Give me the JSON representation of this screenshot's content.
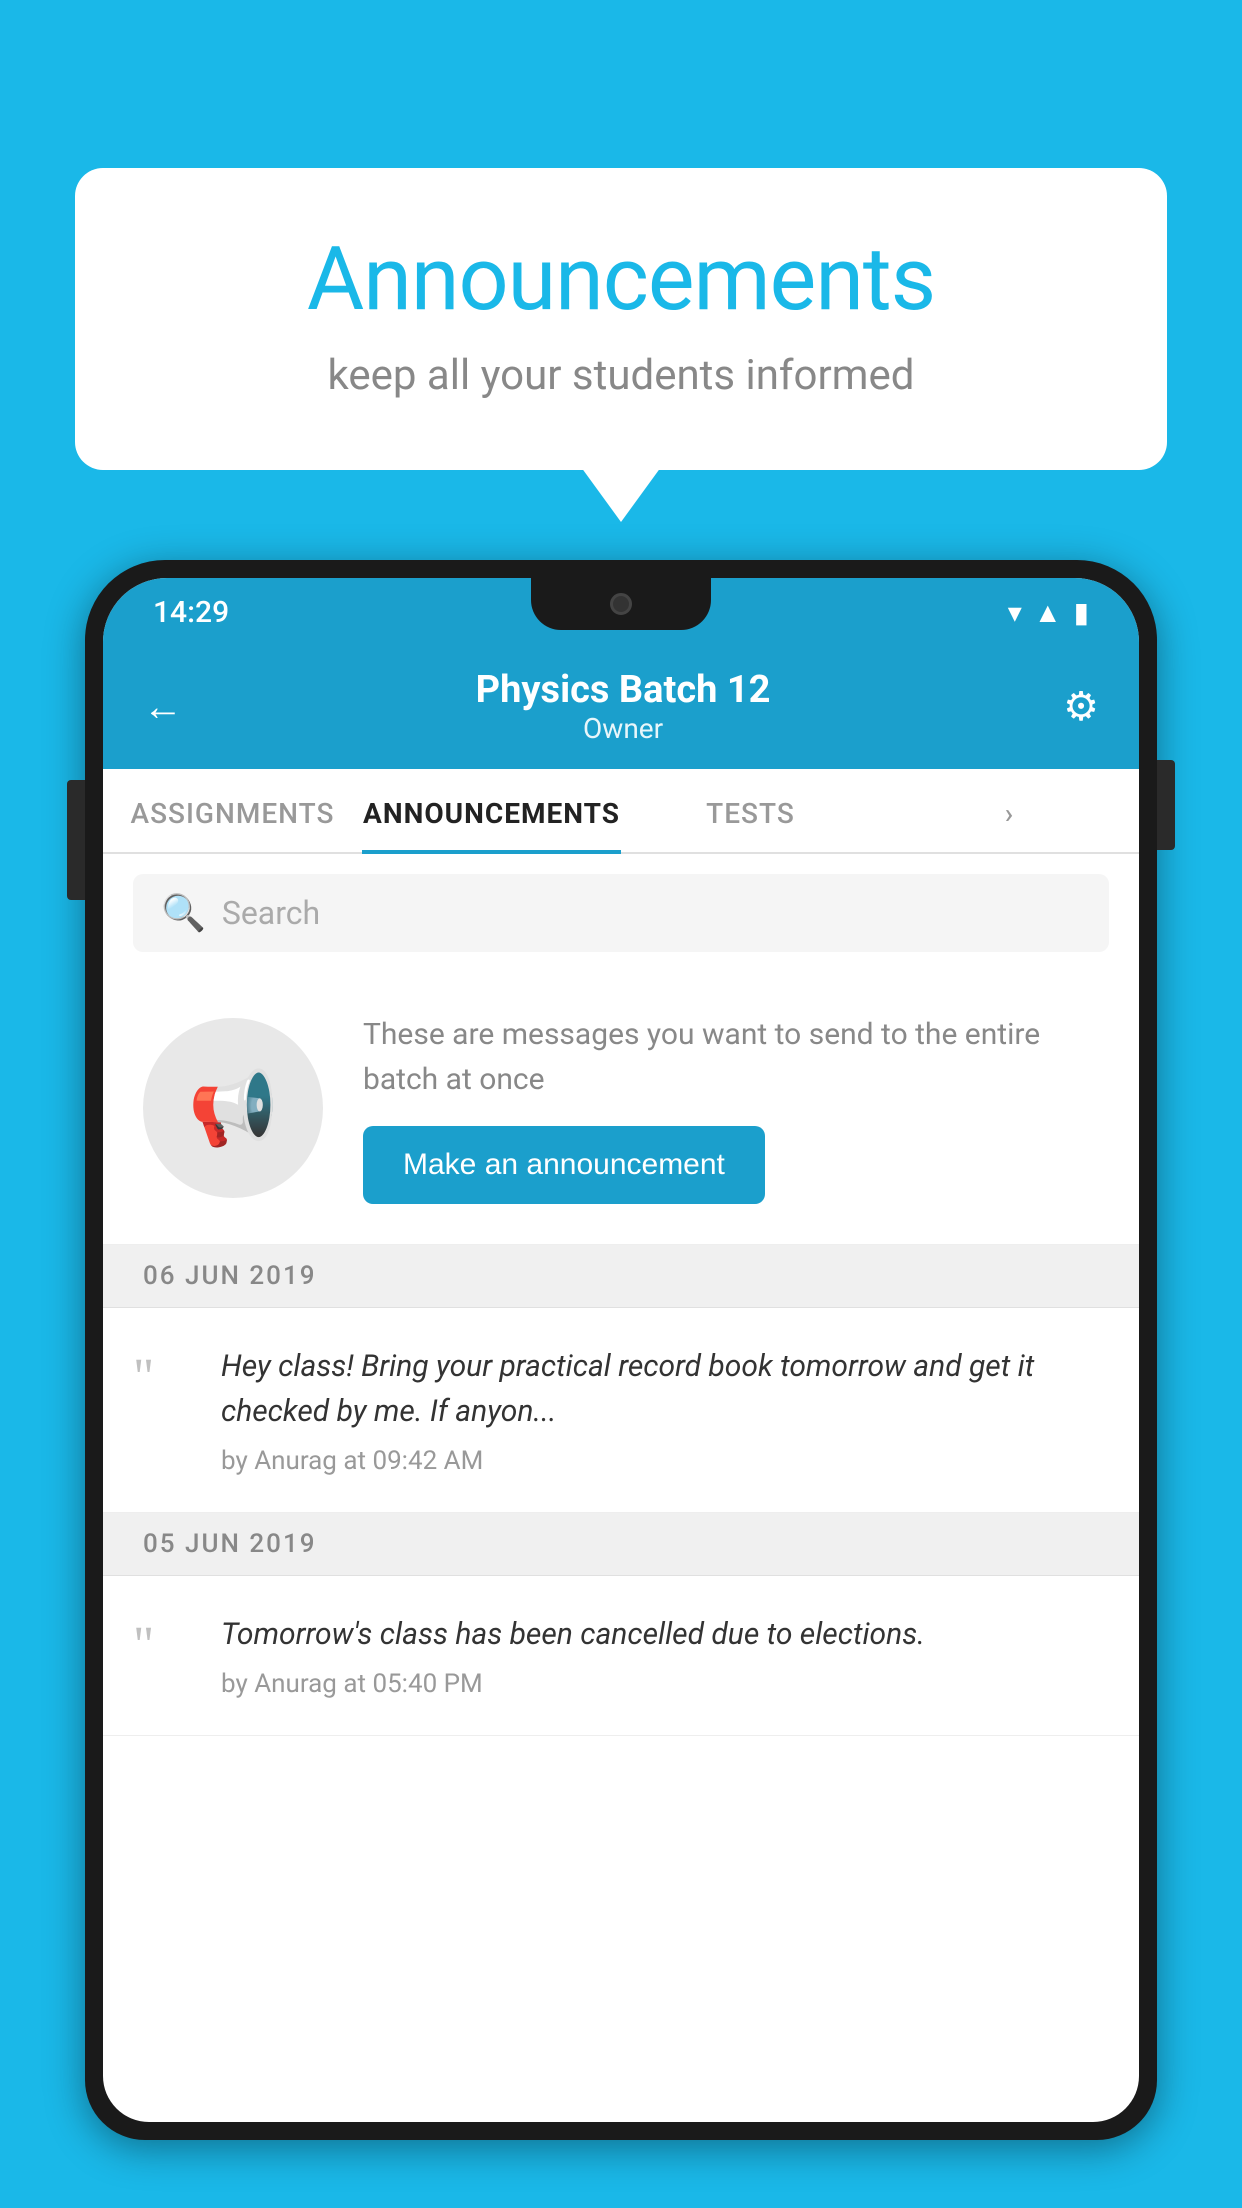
{
  "background": {
    "color": "#1ab8e8"
  },
  "speech_bubble": {
    "title": "Announcements",
    "subtitle": "keep all your students informed"
  },
  "phone": {
    "status_bar": {
      "time": "14:29",
      "wifi": "▼",
      "signal": "▲",
      "battery": "▮"
    },
    "header": {
      "back_label": "←",
      "title": "Physics Batch 12",
      "subtitle": "Owner",
      "gear_label": "⚙"
    },
    "tabs": [
      {
        "label": "ASSIGNMENTS",
        "active": false
      },
      {
        "label": "ANNOUNCEMENTS",
        "active": true
      },
      {
        "label": "TESTS",
        "active": false
      },
      {
        "label": "",
        "active": false
      }
    ],
    "search": {
      "placeholder": "Search"
    },
    "promo": {
      "description": "These are messages you want to send to the entire batch at once",
      "button_label": "Make an announcement"
    },
    "announcements": [
      {
        "date": "06  JUN  2019",
        "text": "Hey class! Bring your practical record book tomorrow and get it checked by me. If anyon...",
        "meta": "by Anurag at 09:42 AM"
      },
      {
        "date": "05  JUN  2019",
        "text": "Tomorrow's class has been cancelled due to elections.",
        "meta": "by Anurag at 05:40 PM"
      }
    ]
  }
}
